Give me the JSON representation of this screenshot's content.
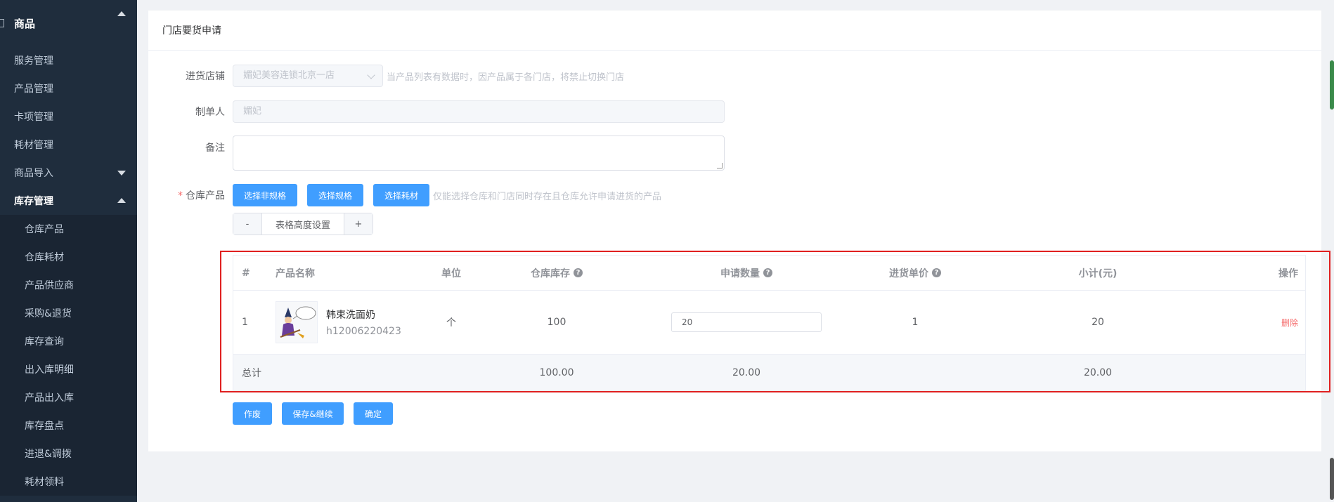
{
  "sidebar": {
    "header": "商品",
    "items": [
      {
        "label": "服务管理"
      },
      {
        "label": "产品管理"
      },
      {
        "label": "卡项管理"
      },
      {
        "label": "耗材管理"
      },
      {
        "label": "商品导入"
      },
      {
        "label": "库存管理"
      }
    ],
    "sub_items": [
      {
        "label": "仓库产品"
      },
      {
        "label": "仓库耗材"
      },
      {
        "label": "产品供应商"
      },
      {
        "label": "采购&退货"
      },
      {
        "label": "库存查询"
      },
      {
        "label": "出入库明细"
      },
      {
        "label": "产品出入库"
      },
      {
        "label": "库存盘点"
      },
      {
        "label": "进退&调拨"
      },
      {
        "label": "耗材领料"
      }
    ]
  },
  "card": {
    "title": "门店要货申请"
  },
  "form": {
    "store_label": "进货店铺",
    "store_value": "媚妃美容连锁北京一店",
    "store_hint": "当产品列表有数据时，因产品属于各门店，将禁止切换门店",
    "creator_label": "制单人",
    "creator_value": "媚妃",
    "remark_label": "备注",
    "product_label": "仓库产品",
    "btn_non_spec": "选择非规格",
    "btn_spec": "选择规格",
    "btn_material": "选择耗材",
    "product_hint": "仅能选择仓库和门店同时存在且仓库允许申请进货的产品",
    "stepper_minus": "-",
    "stepper_label": "表格高度设置",
    "stepper_plus": "+"
  },
  "table": {
    "headers": {
      "index": "#",
      "name": "产品名称",
      "unit": "单位",
      "stock": "仓库库存",
      "qty": "申请数量",
      "price": "进货单价",
      "subtotal": "小计(元)",
      "ops": "操作"
    },
    "rows": [
      {
        "index": "1",
        "name": "韩束洗面奶",
        "code": "h12006220423",
        "unit": "个",
        "stock": "100",
        "qty": "20",
        "price": "1",
        "subtotal": "20",
        "op": "删除"
      }
    ],
    "footer": {
      "label": "总计",
      "stock": "100.00",
      "qty": "20.00",
      "subtotal": "20.00"
    }
  },
  "actions": {
    "void": "作废",
    "save_continue": "保存&继续",
    "confirm": "确定"
  },
  "colors": {
    "primary": "#409eff",
    "danger": "#f56c6c",
    "sidebar_bg": "#1f2d3d"
  }
}
